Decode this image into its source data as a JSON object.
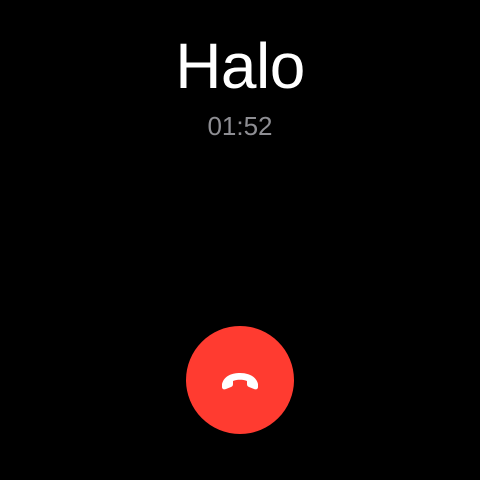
{
  "call": {
    "caller_name": "Halo",
    "duration": "01:52"
  },
  "controls": {
    "end_call": {
      "icon": "phone-hangup-icon",
      "color": "#ff3b30",
      "icon_color": "#ffffff"
    }
  },
  "colors": {
    "background": "#000000",
    "primary_text": "#ffffff",
    "secondary_text": "#8e8e93"
  }
}
